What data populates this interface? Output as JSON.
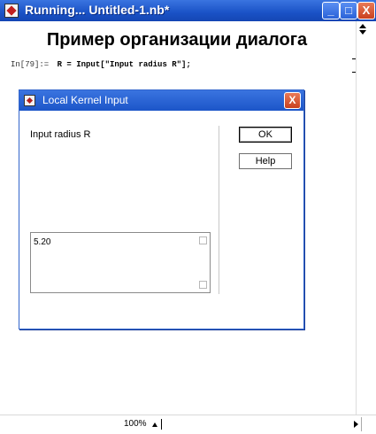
{
  "window": {
    "title": "Running... Untitled-1.nb*",
    "min_glyph": "_",
    "max_glyph": "□",
    "close_glyph": "X"
  },
  "document": {
    "heading": "Пример организации диалога",
    "input_label": "In[79]:=",
    "input_code": "R = Input[\"Input radius R\"];"
  },
  "dialog": {
    "title": "Local Kernel Input",
    "close_glyph": "X",
    "prompt": "Input radius R",
    "ok_label": "OK",
    "help_label": "Help",
    "answer_value": "5.20"
  },
  "status": {
    "zoom": "100%"
  },
  "colors": {
    "titlebar": "#2458d0",
    "close_button": "#d9532f",
    "background": "#ffffff"
  },
  "icons": {
    "app": "mathematica-icon",
    "minimize": "minimize-icon",
    "maximize": "maximize-icon",
    "close": "close-icon"
  }
}
